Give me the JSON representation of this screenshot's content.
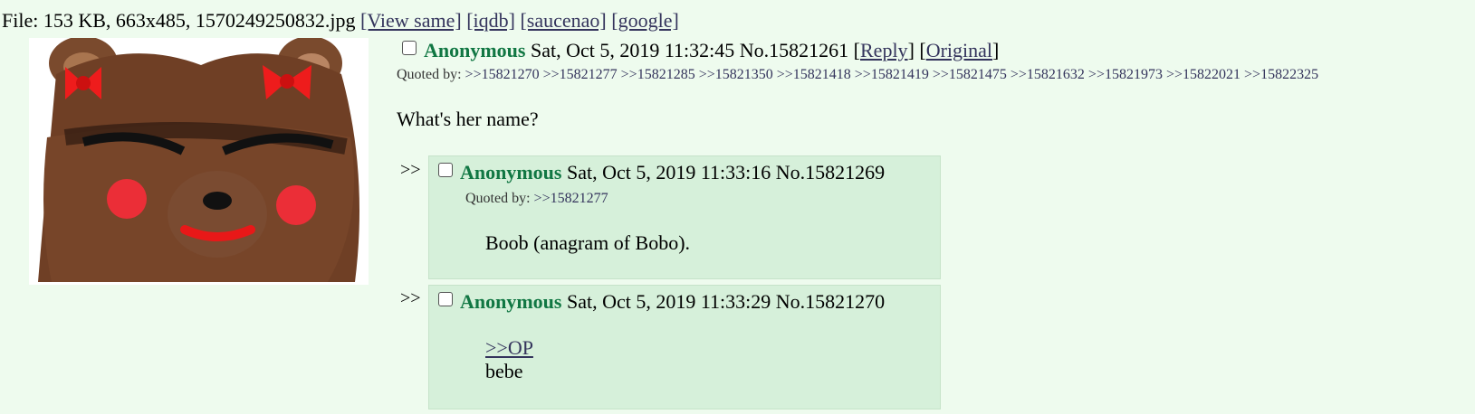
{
  "file": {
    "prefix": "File: 153 KB, 663x485, 1570249250832.jpg",
    "links": [
      "[View same]",
      "[iqdb]",
      "[saucenao]",
      "[google]"
    ]
  },
  "op": {
    "name": "Anonymous",
    "datetime": "Sat, Oct 5, 2019 11:32:45",
    "number": "No.15821261",
    "reply_link": "Reply",
    "original_link": "Original",
    "quoted_by_label": "Quoted by:",
    "quoted_by": ">>15821270 >>15821277 >>15821285 >>15821350 >>15821418 >>15821419 >>15821475 >>15821632 >>15821973 >>15822021 >>15822325",
    "message": "What's her name?"
  },
  "replies": [
    {
      "arrow": ">>",
      "name": "Anonymous",
      "datetime": "Sat, Oct 5, 2019 11:33:16",
      "number": "No.15821269",
      "quoted_by_label": "Quoted by:",
      "quoted_by": ">>15821277",
      "message": "Boob (anagram of Bobo)."
    },
    {
      "arrow": ">>",
      "name": "Anonymous",
      "datetime": "Sat, Oct 5, 2019 11:33:29",
      "number": "No.15821270",
      "quote_link": ">>OP",
      "message": "bebe"
    }
  ],
  "colors": {
    "background": "#eefbee",
    "reply_background": "#d6f0da",
    "name": "#117743",
    "link": "#34345c"
  },
  "icons": {
    "thumbnail": "bear-face-thumbnail",
    "checkbox": "checkbox-icon"
  }
}
